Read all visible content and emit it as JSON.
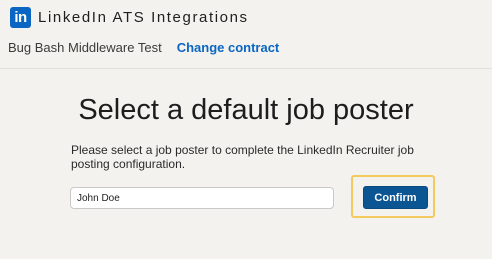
{
  "header": {
    "logo_text": "in",
    "logo_color": "#0a66c2",
    "title": "LinkedIn ATS Integrations"
  },
  "contract": {
    "name": "Bug Bash Middleware Test",
    "change_label": "Change contract"
  },
  "main": {
    "title": "Select a default job poster",
    "description": "Please select a job poster to complete the LinkedIn Recruiter job posting configuration.",
    "poster_input": {
      "value": "John Doe",
      "placeholder": ""
    },
    "confirm_label": "Confirm"
  },
  "colors": {
    "accent": "#0a66c2",
    "button": "#0b5593",
    "highlight": "#f4c95d",
    "background": "#f4f2ee"
  }
}
